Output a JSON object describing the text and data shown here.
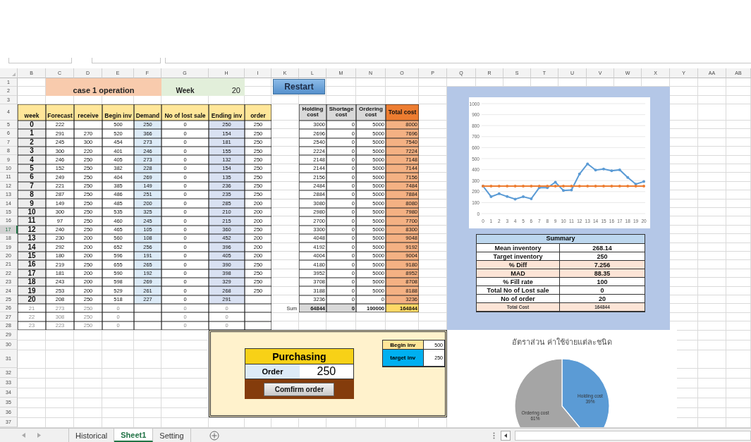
{
  "sheet": {
    "columns": [
      "B",
      "C",
      "D",
      "E",
      "F",
      "G",
      "H",
      "I",
      "K",
      "L",
      "M",
      "N",
      "O",
      "P",
      "Q",
      "R",
      "S",
      "T",
      "U",
      "V",
      "W",
      "X",
      "Y",
      "AA",
      "AB"
    ],
    "row_numbers": [
      {
        "label": "1",
        "selected": false
      },
      {
        "label": "2",
        "selected": false
      },
      {
        "label": "3",
        "selected": false
      },
      {
        "label": "4",
        "selected": false
      },
      {
        "label": "5",
        "selected": false
      },
      {
        "label": "6",
        "selected": false
      },
      {
        "label": "7",
        "selected": false
      },
      {
        "label": "8",
        "selected": false
      },
      {
        "label": "9",
        "selected": false
      },
      {
        "label": "10",
        "selected": false
      },
      {
        "label": "11",
        "selected": false
      },
      {
        "label": "12",
        "selected": false
      },
      {
        "label": "13",
        "selected": false
      },
      {
        "label": "14",
        "selected": false
      },
      {
        "label": "15",
        "selected": false
      },
      {
        "label": "16",
        "selected": false
      },
      {
        "label": "17",
        "selected": true
      },
      {
        "label": "18",
        "selected": false
      },
      {
        "label": "19",
        "selected": false
      },
      {
        "label": "20",
        "selected": false
      },
      {
        "label": "21",
        "selected": false
      },
      {
        "label": "22",
        "selected": false
      },
      {
        "label": "23",
        "selected": false
      },
      {
        "label": "24",
        "selected": false
      },
      {
        "label": "25",
        "selected": false
      },
      {
        "label": "26",
        "selected": false
      },
      {
        "label": "27",
        "selected": false
      },
      {
        "label": "28",
        "selected": false
      },
      {
        "label": "29",
        "selected": false
      },
      {
        "label": "30",
        "selected": false
      },
      {
        "label": "31",
        "selected": false
      },
      {
        "label": "32",
        "selected": false
      },
      {
        "label": "33",
        "selected": false
      },
      {
        "label": "34",
        "selected": false
      },
      {
        "label": "35",
        "selected": false
      },
      {
        "label": "36",
        "selected": false
      },
      {
        "label": "37",
        "selected": false
      }
    ]
  },
  "title": "case 1 operation",
  "week": {
    "label": "Week",
    "value": "20"
  },
  "restart_button": "Restart",
  "inventory_table": {
    "columns": [
      "week",
      "Forecast",
      "receive",
      "Begin inv",
      "Demand",
      "No of lost sale",
      "Ending inv",
      "order"
    ],
    "rows": [
      {
        "week": "0",
        "forecast": "222",
        "begin_inv": "500",
        "demand": "250",
        "lost_sale": "0",
        "ending_inv": "250",
        "order": "250",
        "dimmed": false
      },
      {
        "week": "1",
        "forecast": "291",
        "receive": "270",
        "begin_inv": "520",
        "demand": "366",
        "lost_sale": "0",
        "ending_inv": "154",
        "order": "250",
        "dimmed": false
      },
      {
        "week": "2",
        "forecast": "245",
        "receive": "300",
        "begin_inv": "454",
        "demand": "273",
        "lost_sale": "0",
        "ending_inv": "181",
        "order": "250",
        "dimmed": false
      },
      {
        "week": "3",
        "forecast": "300",
        "receive": "220",
        "begin_inv": "401",
        "demand": "246",
        "lost_sale": "0",
        "ending_inv": "155",
        "order": "250",
        "dimmed": false
      },
      {
        "week": "4",
        "forecast": "246",
        "receive": "250",
        "begin_inv": "405",
        "demand": "273",
        "lost_sale": "0",
        "ending_inv": "132",
        "order": "250",
        "dimmed": false
      },
      {
        "week": "5",
        "forecast": "152",
        "receive": "250",
        "begin_inv": "382",
        "demand": "228",
        "lost_sale": "0",
        "ending_inv": "154",
        "order": "250",
        "dimmed": false
      },
      {
        "week": "6",
        "forecast": "249",
        "receive": "250",
        "begin_inv": "404",
        "demand": "269",
        "lost_sale": "0",
        "ending_inv": "135",
        "order": "250",
        "dimmed": false
      },
      {
        "week": "7",
        "forecast": "221",
        "receive": "250",
        "begin_inv": "385",
        "demand": "149",
        "lost_sale": "0",
        "ending_inv": "236",
        "order": "250",
        "dimmed": false
      },
      {
        "week": "8",
        "forecast": "287",
        "receive": "250",
        "begin_inv": "486",
        "demand": "251",
        "lost_sale": "0",
        "ending_inv": "235",
        "order": "250",
        "dimmed": false
      },
      {
        "week": "9",
        "forecast": "149",
        "receive": "250",
        "begin_inv": "485",
        "demand": "200",
        "lost_sale": "0",
        "ending_inv": "285",
        "order": "200",
        "dimmed": false
      },
      {
        "week": "10",
        "forecast": "300",
        "receive": "250",
        "begin_inv": "535",
        "demand": "325",
        "lost_sale": "0",
        "ending_inv": "210",
        "order": "200",
        "dimmed": false
      },
      {
        "week": "11",
        "forecast": "97",
        "receive": "250",
        "begin_inv": "460",
        "demand": "245",
        "lost_sale": "0",
        "ending_inv": "215",
        "order": "200",
        "dimmed": false
      },
      {
        "week": "12",
        "forecast": "240",
        "receive": "250",
        "begin_inv": "465",
        "demand": "105",
        "lost_sale": "0",
        "ending_inv": "360",
        "order": "250",
        "dimmed": false
      },
      {
        "week": "13",
        "forecast": "230",
        "receive": "200",
        "begin_inv": "560",
        "demand": "108",
        "lost_sale": "0",
        "ending_inv": "452",
        "order": "200",
        "dimmed": false
      },
      {
        "week": "14",
        "forecast": "292",
        "receive": "200",
        "begin_inv": "652",
        "demand": "256",
        "lost_sale": "0",
        "ending_inv": "396",
        "order": "200",
        "dimmed": false
      },
      {
        "week": "15",
        "forecast": "180",
        "receive": "200",
        "begin_inv": "596",
        "demand": "191",
        "lost_sale": "0",
        "ending_inv": "405",
        "order": "200",
        "dimmed": false
      },
      {
        "week": "16",
        "forecast": "219",
        "receive": "250",
        "begin_inv": "655",
        "demand": "265",
        "lost_sale": "0",
        "ending_inv": "390",
        "order": "250",
        "dimmed": false
      },
      {
        "week": "17",
        "forecast": "181",
        "receive": "200",
        "begin_inv": "590",
        "demand": "192",
        "lost_sale": "0",
        "ending_inv": "398",
        "order": "250",
        "dimmed": false
      },
      {
        "week": "18",
        "forecast": "243",
        "receive": "200",
        "begin_inv": "598",
        "demand": "269",
        "lost_sale": "0",
        "ending_inv": "329",
        "order": "250",
        "dimmed": false
      },
      {
        "week": "19",
        "forecast": "253",
        "receive": "200",
        "begin_inv": "529",
        "demand": "261",
        "lost_sale": "0",
        "ending_inv": "268",
        "order": "250",
        "dimmed": false
      },
      {
        "week": "20",
        "forecast": "208",
        "receive": "250",
        "begin_inv": "518",
        "demand": "227",
        "lost_sale": "0",
        "ending_inv": "291",
        "dimmed": false
      },
      {
        "week": "21",
        "forecast": "273",
        "receive": "250",
        "begin_inv": "0",
        "lost_sale": "0",
        "ending_inv": "0",
        "dimmed": true
      },
      {
        "week": "22",
        "forecast": "308",
        "receive": "250",
        "begin_inv": "0",
        "lost_sale": "0",
        "ending_inv": "0",
        "dimmed": true
      },
      {
        "week": "23",
        "forecast": "223",
        "receive": "250",
        "begin_inv": "0",
        "lost_sale": "0",
        "ending_inv": "0",
        "dimmed": true
      }
    ]
  },
  "cost_table": {
    "columns": [
      "Holding cost",
      "Shortage cost",
      "Ordering cost",
      "Total cost"
    ],
    "rows": [
      [
        "3000",
        "0",
        "5000",
        "8000"
      ],
      [
        "2696",
        "0",
        "5000",
        "7696"
      ],
      [
        "2540",
        "0",
        "5000",
        "7540"
      ],
      [
        "2224",
        "0",
        "5000",
        "7224"
      ],
      [
        "2148",
        "0",
        "5000",
        "7148"
      ],
      [
        "2144",
        "0",
        "5000",
        "7144"
      ],
      [
        "2156",
        "0",
        "5000",
        "7156"
      ],
      [
        "2484",
        "0",
        "5000",
        "7484"
      ],
      [
        "2884",
        "0",
        "5000",
        "7884"
      ],
      [
        "3080",
        "0",
        "5000",
        "8080"
      ],
      [
        "2980",
        "0",
        "5000",
        "7980"
      ],
      [
        "2700",
        "0",
        "5000",
        "7700"
      ],
      [
        "3300",
        "0",
        "5000",
        "8300"
      ],
      [
        "4048",
        "0",
        "5000",
        "9048"
      ],
      [
        "4192",
        "0",
        "5000",
        "9192"
      ],
      [
        "4004",
        "0",
        "5000",
        "9004"
      ],
      [
        "4180",
        "0",
        "5000",
        "9180"
      ],
      [
        "3952",
        "0",
        "5000",
        "8952"
      ],
      [
        "3708",
        "0",
        "5000",
        "8708"
      ],
      [
        "3188",
        "0",
        "5000",
        "8188"
      ],
      [
        "3236",
        "0",
        "0",
        "3236"
      ]
    ],
    "sum_label": "Sum",
    "sums": [
      "64844",
      "0",
      "100000",
      "164844"
    ]
  },
  "inventory_chart": {
    "chart_data": {
      "type": "line",
      "grid": true,
      "x": [
        0,
        1,
        2,
        3,
        4,
        5,
        6,
        7,
        8,
        9,
        10,
        11,
        12,
        13,
        14,
        15,
        16,
        17,
        18,
        19,
        20
      ],
      "ylim": [
        0,
        1000
      ],
      "yticks": [
        0,
        100,
        200,
        300,
        400,
        500,
        600,
        700,
        800,
        900,
        1000
      ],
      "series": [
        {
          "color": "#5b9bd5",
          "values": [
            250,
            154,
            181,
            155,
            132,
            154,
            135,
            236,
            235,
            285,
            210,
            215,
            360,
            452,
            396,
            405,
            390,
            398,
            329,
            268,
            291
          ]
        },
        {
          "color": "#ed7d31",
          "values": [
            250,
            250,
            250,
            250,
            250,
            250,
            250,
            250,
            250,
            250,
            250,
            250,
            250,
            250,
            250,
            250,
            250,
            250,
            250,
            250,
            250
          ]
        }
      ]
    }
  },
  "summary": {
    "title": "Summary",
    "rows": [
      {
        "label": "Mean inventory",
        "value": "268.14",
        "highlighted": false,
        "kind": "normal"
      },
      {
        "label": "Target inventory",
        "value": "250",
        "highlighted": false,
        "kind": "normal"
      },
      {
        "label": "% Diff",
        "value": "7.256",
        "highlighted": true,
        "kind": "normal"
      },
      {
        "label": "MAD",
        "value": "88.35",
        "highlighted": true,
        "kind": "normal"
      },
      {
        "label": "% Fill rate",
        "value": "100",
        "highlighted": false,
        "kind": "normal"
      },
      {
        "label": "Total No of Lost sale",
        "value": "0",
        "highlighted": false,
        "kind": "normal"
      },
      {
        "label": "No of order",
        "value": "20",
        "highlighted": false,
        "kind": "normal"
      },
      {
        "label": "Total Cost",
        "value": "164844",
        "highlighted": true,
        "kind": "total"
      }
    ]
  },
  "purchasing": {
    "title": "Purchasing",
    "order_label": "Order",
    "order_value": "250",
    "confirm_button": "Comfirm order"
  },
  "inventory_settings": [
    {
      "label": "Begin inv",
      "value": "500",
      "color": "#ffe699"
    },
    {
      "label": "target inv",
      "value": "250",
      "color": "#00b0f0"
    }
  ],
  "cost_chart": {
    "chart_data": {
      "type": "pie",
      "title": "อัตราส่วน ค่าใช้จ่ายแต่ละชนิด",
      "categories": [
        "Holding cost",
        "Ordering cost"
      ],
      "series": [
        {
          "values": [
            39,
            61
          ]
        }
      ],
      "colors": [
        "#5b9bd5",
        "#a5a5a5"
      ],
      "value_labels": [
        "39%",
        "61%"
      ]
    }
  },
  "sheet_tabs": [
    {
      "label": "Historical",
      "selected": false
    },
    {
      "label": "Sheet1",
      "selected": true
    },
    {
      "label": "Setting",
      "selected": false
    }
  ]
}
